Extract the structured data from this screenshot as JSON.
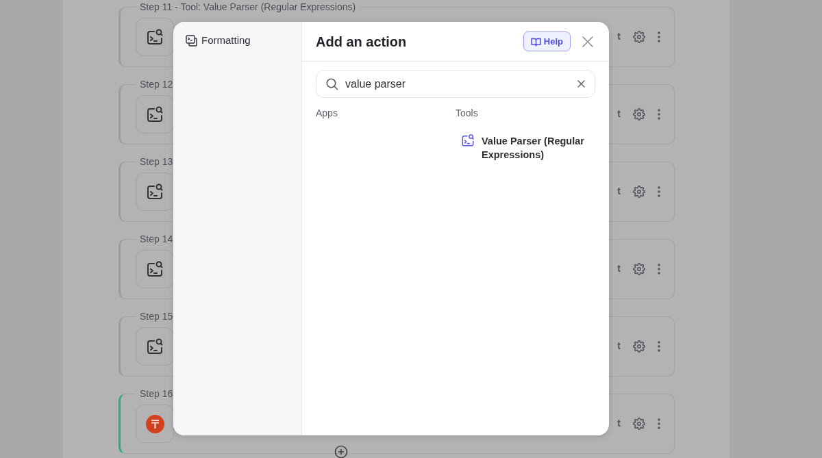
{
  "steps": [
    {
      "legend": "Step 11 - Tool: Value Parser (Regular Expressions)",
      "kind": "tool",
      "active": false,
      "side_text": "t"
    },
    {
      "legend": "Step 12",
      "kind": "tool",
      "active": false,
      "side_text": "t"
    },
    {
      "legend": "Step 13",
      "kind": "tool",
      "active": false,
      "side_text": "t"
    },
    {
      "legend": "Step 14",
      "kind": "tool",
      "active": false,
      "side_text": "t"
    },
    {
      "legend": "Step 15",
      "kind": "tool",
      "active": false,
      "side_text": "t"
    },
    {
      "legend": "Step 16",
      "kind": "app",
      "active": true,
      "side_text": "t"
    }
  ],
  "modal": {
    "sidebar": {
      "items": [
        {
          "label": "Formatting",
          "selected": false
        }
      ]
    },
    "title": "Add an action",
    "help_button": "Help",
    "search": {
      "value": "value parser"
    },
    "columns": [
      {
        "heading": "Apps"
      },
      {
        "heading": "Tools",
        "results": [
          {
            "label": "Value Parser (Regular Expressions)"
          }
        ]
      }
    ]
  }
}
